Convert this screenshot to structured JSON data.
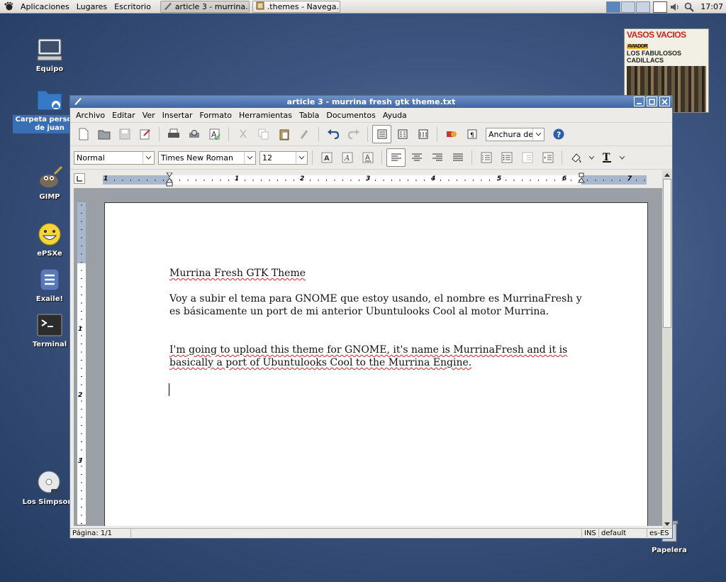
{
  "panel": {
    "menus": [
      "Aplicaciones",
      "Lugares",
      "Escritorio"
    ],
    "tasks": [
      {
        "label": "article 3 - murrina...",
        "active": true
      },
      {
        "label": ".themes - Navega...",
        "active": false
      }
    ],
    "clock": "17:07"
  },
  "desktop": {
    "icons": [
      {
        "label": "Equipo"
      },
      {
        "label": "Carpeta personal de juan"
      },
      {
        "label": "GIMP"
      },
      {
        "label": "ePSXe"
      },
      {
        "label": "Exaile!"
      },
      {
        "label": "Terminal"
      },
      {
        "label": "Los Simpsons"
      },
      {
        "label": "Papelera"
      }
    ],
    "album": {
      "title": "VASOS VACIOS",
      "subtitle": "LOS FABULOSOS CADILLACS",
      "badge": "AVIADOR"
    }
  },
  "window": {
    "title": "article 3 - murrina fresh gtk theme.txt",
    "menus": [
      "Archivo",
      "Editar",
      "Ver",
      "Insertar",
      "Formato",
      "Herramientas",
      "Tabla",
      "Documentos",
      "Ayuda"
    ],
    "zoom": "Anchura de",
    "format": {
      "style": "Normal",
      "font": "Times New Roman",
      "size": "12"
    },
    "ruler_numbers": [
      "1",
      "1",
      "2",
      "3",
      "4",
      "5",
      "6",
      "7"
    ],
    "vruler_numbers": [
      "1",
      "2",
      "3"
    ],
    "document": {
      "paragraphs": [
        "Murrina Fresh GTK Theme",
        "Voy a subir el tema para GNOME que estoy usando, el nombre es MurrinaFresh y es básicamente un port de mi anterior Ubuntulooks Cool al motor Murrina.",
        "I'm going to upload this theme for GNOME, it's name is MurrinaFresh and it is basically a port of Ubuntulooks Cool to the Murrina Engine."
      ]
    },
    "status": {
      "page": "Página: 1/1",
      "mode": "INS",
      "style": "default",
      "lang": "es-ES"
    }
  }
}
